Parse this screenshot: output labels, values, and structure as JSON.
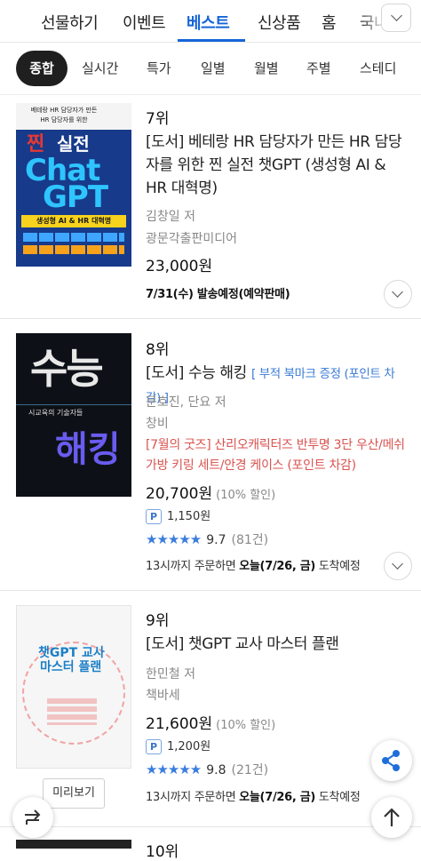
{
  "top_tabs": [
    "선물하기",
    "이벤트",
    "베스트",
    "신상품",
    "홈",
    "국내"
  ],
  "active_tab": "베스트",
  "chips": [
    "종합",
    "실시간",
    "특가",
    "일별",
    "월별",
    "주별",
    "스테디"
  ],
  "active_chip": "종합",
  "colors": {
    "accent": "#1565d8",
    "star": "#3b7ddd",
    "promo": "#d9534f"
  },
  "items": [
    {
      "rank": "7위",
      "title": "[도서] 베테랑 HR 담당자가 만든 HR 담당자를 위한 찐 실전 챗GPT (생성형 AI & HR 대혁명)",
      "author": "김창일 저",
      "publisher": "광문각출판미디어",
      "price": "23,000원",
      "shipping_bold": "7/31(수) 발송예정(예약판매)",
      "cover": {
        "top1": "베테랑 HR 담당자가 만든",
        "top2": "HR 담당자를 위한",
        "jjin": "찐",
        "silj": "실전",
        "chat": "Chat",
        "gpt": "GPT",
        "band": "생성형 AI & HR 대혁명"
      }
    },
    {
      "rank": "8위",
      "title": "[도서] 수능 해킹",
      "gift_tag": "[ 부적 북마크 증정 (포인트 차감) ]",
      "author": "문호진, 단요 저",
      "publisher": "창비",
      "promo": "[7월의 굿즈] 산리오캐릭터즈 반투명 3단 우산/메쉬가방 키링 세트/안경 케이스 (포인트 차감)",
      "price": "20,700원",
      "discount": "(10% 할인)",
      "point_badge": "P",
      "points": "1,150원",
      "stars": "★★★★★",
      "rating": "9.7",
      "review_count": "(81건)",
      "ship_prefix": "13시까지 주문하면 ",
      "ship_bold": "오늘(7/26, 금)",
      "ship_suffix": " 도착예정",
      "cover": {
        "big1": "수능",
        "sub": "시교육의 기술자들",
        "big2": "해킹"
      }
    },
    {
      "rank": "9위",
      "title": "[도서] 챗GPT 교사 마스터 플랜",
      "author": "한민철 저",
      "publisher": "책바세",
      "price": "21,600원",
      "discount": "(10% 할인)",
      "point_badge": "P",
      "points": "1,200원",
      "stars": "★★★★★",
      "rating": "9.8",
      "review_count": "(21건)",
      "ship_prefix": "13시까지 주문하면 ",
      "ship_bold": "오늘(7/26, 금)",
      "ship_suffix": " 도착예정",
      "preview_label": "미리보기",
      "cover": {
        "line1": "챗GPT 교사",
        "line2": "마스터 플랜"
      }
    },
    {
      "rank": "10위"
    }
  ]
}
